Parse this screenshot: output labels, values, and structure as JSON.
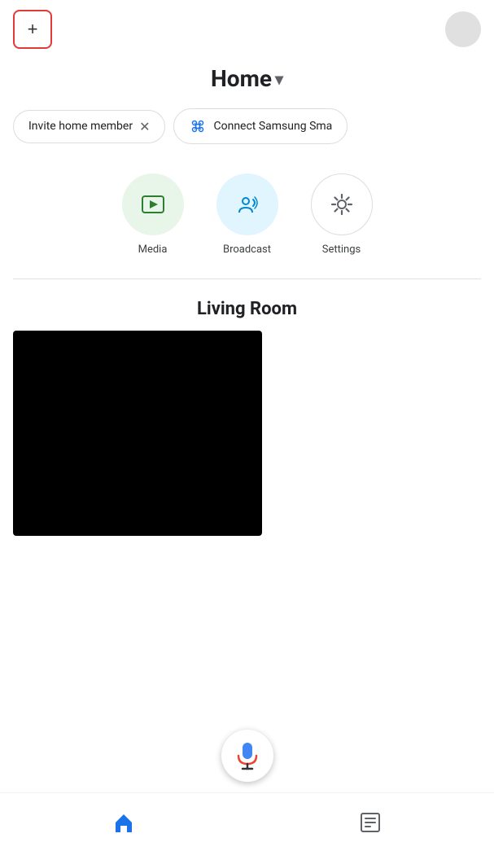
{
  "header": {
    "add_label": "+",
    "title": "Home",
    "title_chevron": "▾"
  },
  "chips": [
    {
      "id": "invite",
      "label": "Invite home member",
      "has_close": true
    },
    {
      "id": "samsung",
      "label": "Connect Samsung Sma",
      "has_close": false
    }
  ],
  "features": [
    {
      "id": "media",
      "label": "Media",
      "style": "green"
    },
    {
      "id": "broadcast",
      "label": "Broadcast",
      "style": "blue"
    },
    {
      "id": "settings",
      "label": "Settings",
      "style": "gray"
    }
  ],
  "room": {
    "title": "Living Room"
  },
  "bottom_nav": {
    "home_label": "home",
    "routines_label": "routines"
  },
  "colors": {
    "accent_red": "#e53935",
    "green_bg": "#e8f5e9",
    "blue_bg": "#e1f5fe",
    "home_icon_color": "#1a73e8"
  }
}
